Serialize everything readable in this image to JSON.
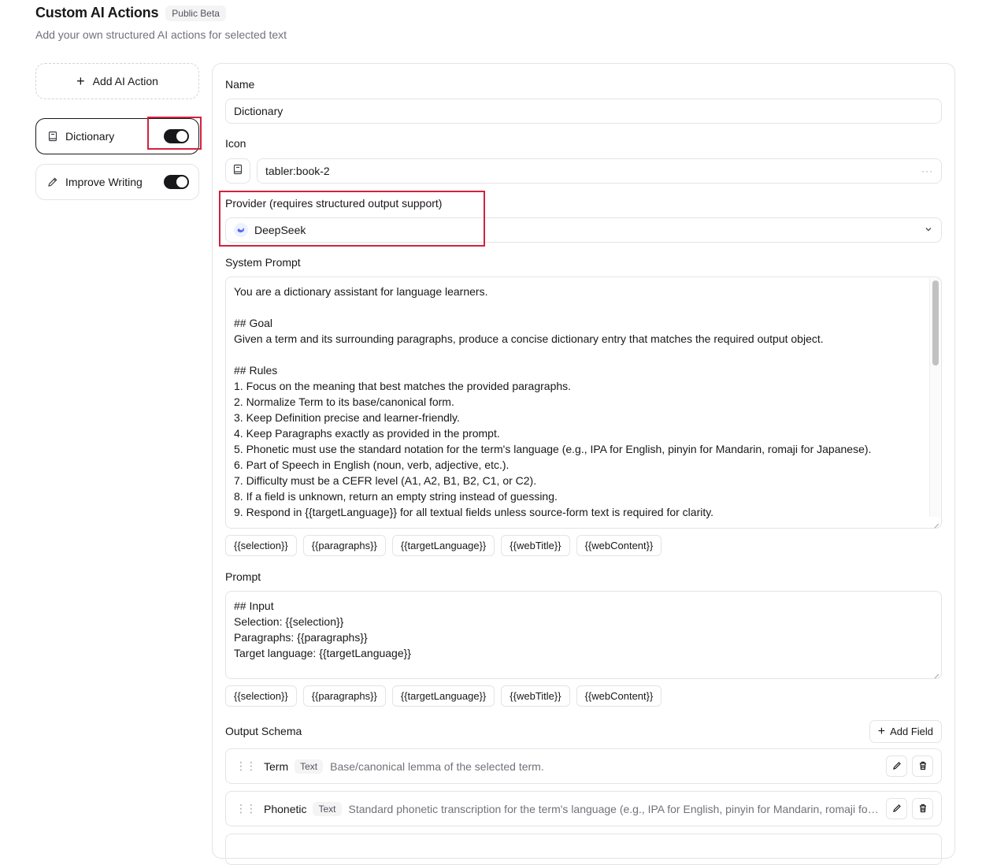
{
  "header": {
    "title": "Custom AI Actions",
    "badge": "Public Beta",
    "subtitle": "Add your own structured AI actions for selected text"
  },
  "sidebar": {
    "add_label": "Add AI Action",
    "items": [
      {
        "label": "Dictionary",
        "icon": "book-icon",
        "enabled": true,
        "active": true
      },
      {
        "label": "Improve Writing",
        "icon": "pencil-icon",
        "enabled": true,
        "active": false
      }
    ]
  },
  "form": {
    "name_label": "Name",
    "name_value": "Dictionary",
    "icon_label": "Icon",
    "icon_value": "tabler:book-2",
    "icon_more": "···",
    "provider_label": "Provider (requires structured output support)",
    "provider_value": "DeepSeek",
    "system_prompt_label": "System Prompt",
    "system_prompt_lines": [
      "You are a dictionary assistant for language learners.",
      "",
      "## Goal",
      "Given a term and its surrounding paragraphs, produce a concise dictionary entry that matches the required output object.",
      "",
      "## Rules",
      "1. Focus on the meaning that best matches the provided paragraphs.",
      "2. Normalize Term to its base/canonical form.",
      "3. Keep Definition precise and learner-friendly.",
      "4. Keep Paragraphs exactly as provided in the prompt.",
      "5. Phonetic must use the standard notation for the term's language (e.g., IPA for English, pinyin for Mandarin, romaji for Japanese).",
      "6. Part of Speech in English (noun, verb, adjective, etc.).",
      "7. Difficulty must be a CEFR level (A1, A2, B1, B2, C1, or C2).",
      "8. If a field is unknown, return an empty string instead of guessing.",
      "9. Respond in {{targetLanguage}} for all textual fields unless source-form text is required for clarity."
    ],
    "variables": [
      "{{selection}}",
      "{{paragraphs}}",
      "{{targetLanguage}}",
      "{{webTitle}}",
      "{{webContent}}"
    ],
    "prompt_label": "Prompt",
    "prompt_lines": [
      "## Input",
      "Selection: {{selection}}",
      "Paragraphs: {{paragraphs}}",
      "Target language: {{targetLanguage}}"
    ],
    "output_schema_label": "Output Schema",
    "add_field_label": "Add Field",
    "fields": [
      {
        "name": "Term",
        "type": "Text",
        "description": "Base/canonical lemma of the selected term."
      },
      {
        "name": "Phonetic",
        "type": "Text",
        "description": "Standard phonetic transcription for the term's language (e.g., IPA for English, pinyin for Mandarin, romaji for Japanese)."
      }
    ]
  },
  "colors": {
    "accent": "#18181b",
    "highlight": "#d4213d",
    "border": "#e4e4e7",
    "muted": "#71717a"
  }
}
